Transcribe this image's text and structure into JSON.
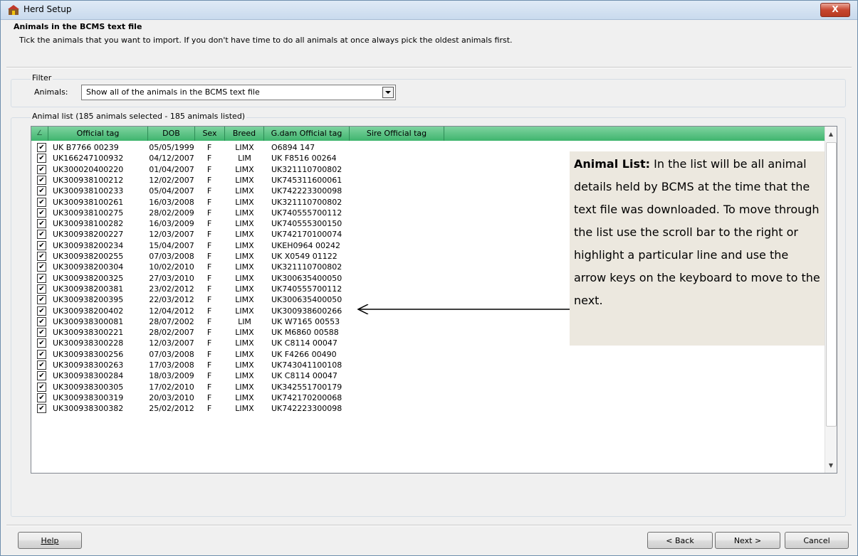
{
  "window": {
    "title": "Herd Setup",
    "close_label": "X"
  },
  "header": {
    "title": "Animals in the BCMS text file",
    "description": "Tick the animals that you want to import. If you don't have time to do all animals at once always pick the oldest animals first."
  },
  "filter": {
    "group_label": "Filter",
    "animals_label": "Animals:",
    "selected_option": "Show all of the animals in the BCMS text file"
  },
  "animal_list": {
    "group_label": "Animal list (185 animals selected - 185 animals listed)",
    "columns": [
      "Official tag",
      "DOB",
      "Sex",
      "Breed",
      "G.dam Official tag",
      "Sire Official tag"
    ],
    "rows": [
      [
        "UK B7766 00239",
        "05/05/1999",
        "F",
        "LIMX",
        "O6894 147",
        ""
      ],
      [
        "UK166247100932",
        "04/12/2007",
        "F",
        "LIM",
        "UK F8516 00264",
        ""
      ],
      [
        "UK300020400220",
        "01/04/2007",
        "F",
        "LIMX",
        "UK321110700802",
        ""
      ],
      [
        "UK300938100212",
        "12/02/2007",
        "F",
        "LIMX",
        "UK745311600061",
        ""
      ],
      [
        "UK300938100233",
        "05/04/2007",
        "F",
        "LIMX",
        "UK742223300098",
        ""
      ],
      [
        "UK300938100261",
        "16/03/2008",
        "F",
        "LIMX",
        "UK321110700802",
        ""
      ],
      [
        "UK300938100275",
        "28/02/2009",
        "F",
        "LIMX",
        "UK740555700112",
        ""
      ],
      [
        "UK300938100282",
        "16/03/2009",
        "F",
        "LIMX",
        "UK740555300150",
        ""
      ],
      [
        "UK300938200227",
        "12/03/2007",
        "F",
        "LIMX",
        "UK742170100074",
        ""
      ],
      [
        "UK300938200234",
        "15/04/2007",
        "F",
        "LIMX",
        "UKEH0964 00242",
        ""
      ],
      [
        "UK300938200255",
        "07/03/2008",
        "F",
        "LIMX",
        "UK X0549 01122",
        ""
      ],
      [
        "UK300938200304",
        "10/02/2010",
        "F",
        "LIMX",
        "UK321110700802",
        ""
      ],
      [
        "UK300938200325",
        "27/03/2010",
        "F",
        "LIMX",
        "UK300635400050",
        ""
      ],
      [
        "UK300938200381",
        "23/02/2012",
        "F",
        "LIMX",
        "UK740555700112",
        ""
      ],
      [
        "UK300938200395",
        "22/03/2012",
        "F",
        "LIMX",
        "UK300635400050",
        ""
      ],
      [
        "UK300938200402",
        "12/04/2012",
        "F",
        "LIMX",
        "UK300938600266",
        ""
      ],
      [
        "UK300938300081",
        "28/07/2002",
        "F",
        "LIM",
        "UK W7165 00553",
        ""
      ],
      [
        "UK300938300221",
        "28/02/2007",
        "F",
        "LIMX",
        "UK M6860 00588",
        ""
      ],
      [
        "UK300938300228",
        "12/03/2007",
        "F",
        "LIMX",
        "UK C8114 00047",
        ""
      ],
      [
        "UK300938300256",
        "07/03/2008",
        "F",
        "LIMX",
        "UK F4266 00490",
        ""
      ],
      [
        "UK300938300263",
        "17/03/2008",
        "F",
        "LIMX",
        "UK743041100108",
        ""
      ],
      [
        "UK300938300284",
        "18/03/2009",
        "F",
        "LIMX",
        "UK C8114 00047",
        ""
      ],
      [
        "UK300938300305",
        "17/02/2010",
        "F",
        "LIMX",
        "UK342551700179",
        ""
      ],
      [
        "UK300938300319",
        "20/03/2010",
        "F",
        "LIMX",
        "UK742170200068",
        ""
      ],
      [
        "UK300938300382",
        "25/02/2012",
        "F",
        "LIMX",
        "UK742223300098",
        ""
      ]
    ]
  },
  "callout": {
    "bold_label": "Animal List:",
    "text": " In the list will be all animal details held by BCMS at the time that the text file was downloaded. To move through the list use the scroll bar to the right or highlight a particular line and use the arrow keys on the keyboard to move to the next."
  },
  "buttons": {
    "help": "Help",
    "back": "< Back",
    "next": "Next >",
    "cancel": "Cancel"
  },
  "colors": {
    "list_header": "#3fb56e",
    "callout_bg": "#ece8df",
    "close_button": "#c7462f"
  }
}
